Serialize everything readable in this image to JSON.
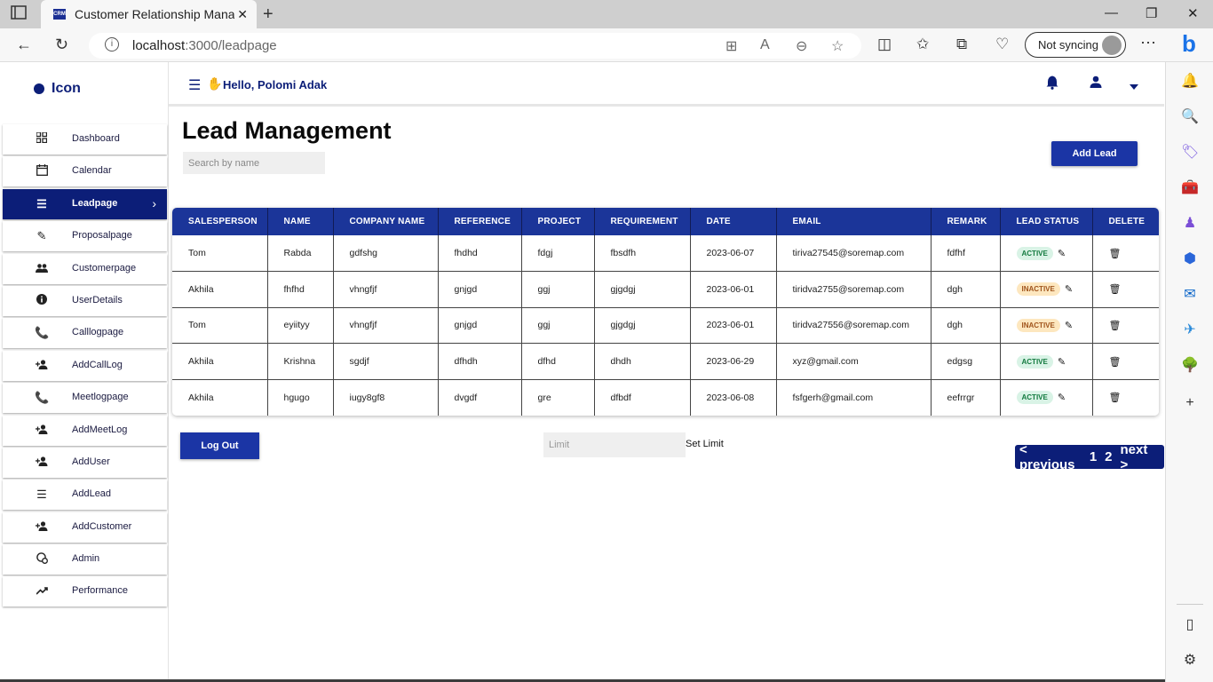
{
  "browser": {
    "tab_title": "Customer Relationship Managem",
    "favicon_text": "CRM",
    "url_host": "localhost",
    "url_path": ":3000/leadpage",
    "sync_label": "Not syncing"
  },
  "sidebar": {
    "brand": "Icon",
    "items": [
      {
        "label": "Dashboard",
        "icon": "grid-icon"
      },
      {
        "label": "Calendar",
        "icon": "calendar-icon"
      },
      {
        "label": "Leadpage",
        "icon": "list-icon",
        "active": true
      },
      {
        "label": "Proposalpage",
        "icon": "edit-note-icon"
      },
      {
        "label": "Customerpage",
        "icon": "people-icon"
      },
      {
        "label": "UserDetails",
        "icon": "info-icon"
      },
      {
        "label": "Calllogpage",
        "icon": "phone-add-icon"
      },
      {
        "label": "AddCallLog",
        "icon": "person-add-icon"
      },
      {
        "label": "Meetlogpage",
        "icon": "phone-add-icon"
      },
      {
        "label": "AddMeetLog",
        "icon": "person-add-icon"
      },
      {
        "label": "AddUser",
        "icon": "person-add-icon"
      },
      {
        "label": "AddLead",
        "icon": "list-icon"
      },
      {
        "label": "AddCustomer",
        "icon": "person-add-icon"
      },
      {
        "label": "Admin",
        "icon": "admin-icon"
      },
      {
        "label": "Performance",
        "icon": "trending-up-icon"
      }
    ]
  },
  "header": {
    "greeting": "Hello, Polomi Adak"
  },
  "main": {
    "title": "Lead Management",
    "search_placeholder": "Search by name",
    "add_lead_label": "Add Lead",
    "logout_label": "Log Out",
    "limit_placeholder": "Limit",
    "set_limit_label": "Set Limit",
    "pager": {
      "prev": "< previous",
      "pages": [
        "1",
        "2"
      ],
      "next": "next >"
    }
  },
  "table": {
    "columns": [
      "SALESPERSON",
      "NAME",
      "COMPANY NAME",
      "REFERENCE",
      "PROJECT",
      "REQUIREMENT",
      "DATE",
      "EMAIL",
      "REMARK",
      "LEAD STATUS",
      "DELETE"
    ],
    "rows": [
      {
        "salesperson": "Tom",
        "name": "Rabda",
        "company": "gdfshg",
        "reference": "fhdhd",
        "project": "fdgj",
        "requirement": "fbsdfh",
        "date": "2023-06-07",
        "email": "tiriva27545@soremap.com",
        "remark": "fdfhf",
        "status": "ACTIVE"
      },
      {
        "salesperson": "Akhila",
        "name": "fhfhd",
        "company": "vhngfjf",
        "reference": "gnjgd",
        "project": "ggj",
        "requirement": "gjgdgj",
        "date": "2023-06-01",
        "email": "tiridva2755@soremap.com",
        "remark": "dgh",
        "status": "INACTIVE"
      },
      {
        "salesperson": "Tom",
        "name": "eyiityy",
        "company": "vhngfjf",
        "reference": "gnjgd",
        "project": "ggj",
        "requirement": "gjgdgj",
        "date": "2023-06-01",
        "email": "tiridva27556@soremap.com",
        "remark": "dgh",
        "status": "INACTIVE"
      },
      {
        "salesperson": "Akhila",
        "name": "Krishna",
        "company": "sgdjf",
        "reference": "dfhdh",
        "project": "dfhd",
        "requirement": "dhdh",
        "date": "2023-06-29",
        "email": "xyz@gmail.com",
        "remark": "edgsg",
        "status": "ACTIVE"
      },
      {
        "salesperson": "Akhila",
        "name": "hgugo",
        "company": "iugy8gf8",
        "reference": "dvgdf",
        "project": "gre",
        "requirement": "dfbdf",
        "date": "2023-06-08",
        "email": "fsfgerh@gmail.com",
        "remark": "eefrrgr",
        "status": "ACTIVE"
      }
    ]
  },
  "colors": {
    "brand_navy": "#0c1e78",
    "header_blue": "#1b3599",
    "button_blue": "#1b35a5",
    "active_badge_bg": "#d9f3e6",
    "inactive_badge_bg": "#fde7bf"
  }
}
